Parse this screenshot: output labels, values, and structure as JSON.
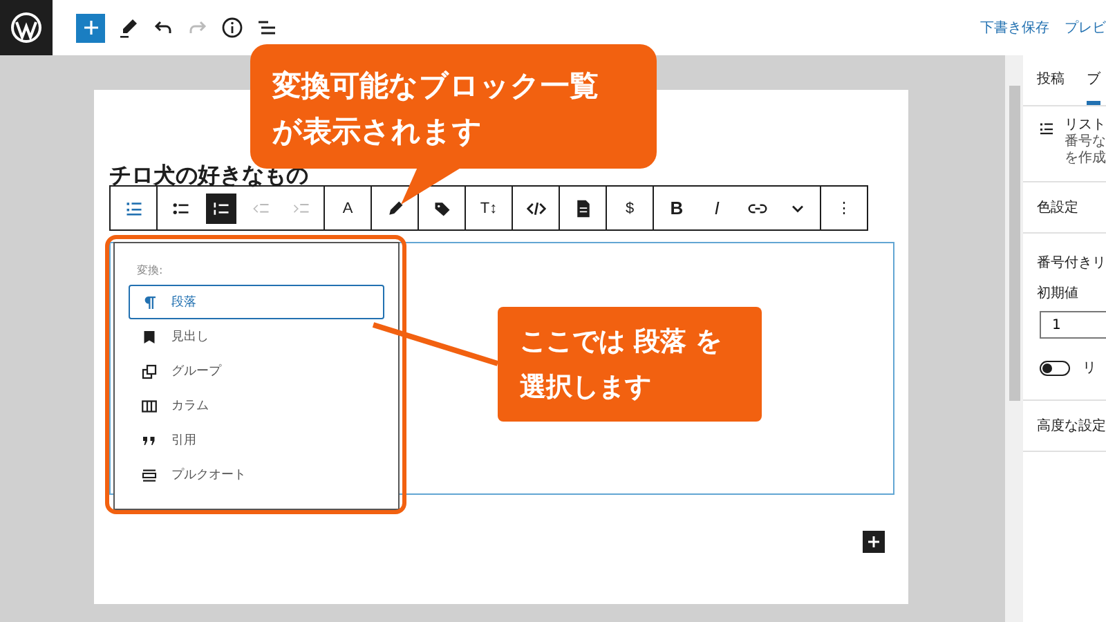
{
  "topbar": {
    "actions": [
      "下書き保存",
      "プレビ"
    ]
  },
  "post_title": "チロ犬の好きなもの",
  "block_toolbar": [
    {
      "items": [
        {
          "kind": "list",
          "selected": false,
          "disabled": false
        }
      ]
    },
    {
      "items": [
        {
          "kind": "bullets",
          "selected": false,
          "disabled": false
        },
        {
          "kind": "numbered",
          "selected": true,
          "disabled": false
        },
        {
          "kind": "outdent",
          "selected": false,
          "disabled": true
        },
        {
          "kind": "indent",
          "selected": false,
          "disabled": true
        }
      ]
    },
    {
      "items": [
        {
          "kind": "label",
          "label": "A",
          "selected": false,
          "disabled": false
        }
      ]
    },
    {
      "items": [
        {
          "kind": "pen",
          "selected": false,
          "disabled": false
        }
      ]
    },
    {
      "items": [
        {
          "kind": "tag",
          "selected": false,
          "disabled": false
        }
      ]
    },
    {
      "items": [
        {
          "kind": "label",
          "label": "T↕",
          "selected": false,
          "disabled": false
        }
      ]
    },
    {
      "items": [
        {
          "kind": "code",
          "selected": false,
          "disabled": false
        }
      ]
    },
    {
      "items": [
        {
          "kind": "doc",
          "selected": false,
          "disabled": false
        }
      ]
    },
    {
      "items": [
        {
          "kind": "label",
          "label": "$",
          "selected": false,
          "disabled": false
        }
      ]
    },
    {
      "items": [
        {
          "kind": "bold",
          "label": "B",
          "selected": false,
          "disabled": false
        },
        {
          "kind": "italic",
          "label": "I",
          "selected": false,
          "disabled": false
        },
        {
          "kind": "link",
          "selected": false,
          "disabled": false
        },
        {
          "kind": "chevron",
          "selected": false,
          "disabled": false
        }
      ]
    },
    {
      "items": [
        {
          "kind": "label",
          "label": "⋮",
          "selected": false,
          "disabled": false
        }
      ]
    }
  ],
  "transform_menu": {
    "heading": "変換:",
    "items": [
      {
        "kind": "paragraph",
        "label": "段落",
        "selected": true
      },
      {
        "kind": "heading",
        "label": "見出し",
        "selected": false
      },
      {
        "kind": "group",
        "label": "グループ",
        "selected": false
      },
      {
        "kind": "columns",
        "label": "カラム",
        "selected": false
      },
      {
        "kind": "quote",
        "label": "引用",
        "selected": false
      },
      {
        "kind": "pullquote",
        "label": "プルクオート",
        "selected": false
      }
    ]
  },
  "sidebar": {
    "tabs": [
      {
        "label": "投稿",
        "selected": false
      },
      {
        "label": "ブ",
        "selected": true
      }
    ],
    "block_card": {
      "title": "リスト",
      "description": [
        "番号な",
        "を作成"
      ]
    },
    "panels": [
      {
        "kind": "heading",
        "title": "色設定"
      },
      {
        "kind": "settings",
        "title": "番号付きリ",
        "field_label": "初期値",
        "field_value": "1",
        "toggle_label": "リ",
        "toggle_on": false
      },
      {
        "kind": "heading",
        "title": "高度な設定"
      }
    ]
  },
  "callouts": [
    {
      "kind": "tail",
      "lines": [
        "変換可能なブロック一覧",
        "が表示されます"
      ]
    },
    {
      "kind": "leader",
      "lines": [
        "ここでは 段落 を",
        "選択します"
      ]
    }
  ]
}
